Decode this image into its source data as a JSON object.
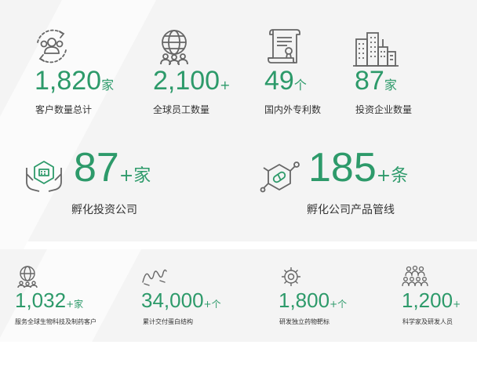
{
  "colors": {
    "accent": "#2d9a6a",
    "icon": "#666666",
    "panel": "#f4f4f4",
    "text": "#333333"
  },
  "top_stats": [
    {
      "value": "1,820",
      "suffix": "家",
      "label": "客户数量总计",
      "icon": "customers-cycle-icon"
    },
    {
      "value": "2,100",
      "suffix": "+",
      "label": "全球员工数量",
      "icon": "global-employees-icon"
    },
    {
      "value": "49",
      "suffix": "个",
      "label": "国内外专利数",
      "icon": "patent-certificate-icon"
    },
    {
      "value": "87",
      "suffix": "家",
      "label": "投资企业数量",
      "icon": "city-buildings-icon"
    }
  ],
  "mid_stats": [
    {
      "value": "87",
      "suffix": "+家",
      "label": "孵化投资公司",
      "icon": "hands-incubation-icon"
    },
    {
      "value": "185",
      "suffix": "+条",
      "label": "孵化公司产品管线",
      "icon": "molecule-capsule-icon"
    }
  ],
  "bottom_stats": [
    {
      "value": "1,032",
      "suffix": "+家",
      "label": "服务全球生物科技及制药客户",
      "icon": "globe-people-icon"
    },
    {
      "value": "34,000",
      "suffix": "+个",
      "label": "累计交付蛋白结构",
      "icon": "protein-coil-icon"
    },
    {
      "value": "1,800",
      "suffix": "+个",
      "label": "研发独立药物靶标",
      "icon": "target-gear-icon"
    },
    {
      "value": "1,200",
      "suffix": "+",
      "label": "科学家及研发人员",
      "icon": "scientists-group-icon"
    }
  ]
}
